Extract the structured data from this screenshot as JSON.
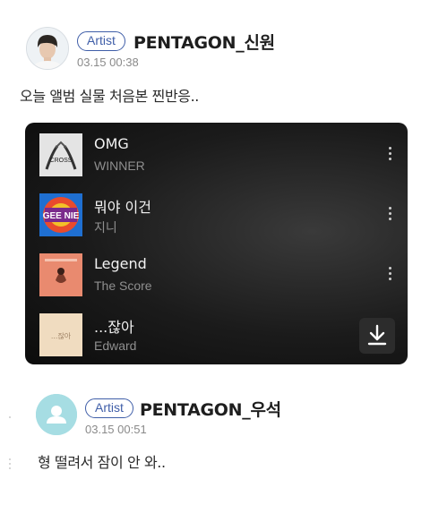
{
  "post1": {
    "badge": "Artist",
    "name": "PENTAGON_신원",
    "timestamp": "03.15 00:38",
    "text": "오늘 앨범 실물 처음본 찐반응.."
  },
  "playlist": {
    "tracks": [
      {
        "title": "OMG",
        "artist": "WINNER",
        "cover_label": "CROSS"
      },
      {
        "title": "뭐야 이건",
        "artist": "지니",
        "cover_label": "GEE NIE"
      },
      {
        "title": "Legend",
        "artist": "The Score",
        "cover_label": ""
      },
      {
        "title": "...잖아",
        "artist": "Edward",
        "cover_label": "...잖아"
      }
    ],
    "download_icon": "download-icon"
  },
  "post2": {
    "badge": "Artist",
    "name": "PENTAGON_우석",
    "timestamp": "03.15 00:51",
    "text": "형 떨려서 잠이 안 와.."
  },
  "colors": {
    "badge": "#3f5ea8",
    "player_bg": "#141414",
    "avatar2": "#a6dde3"
  }
}
